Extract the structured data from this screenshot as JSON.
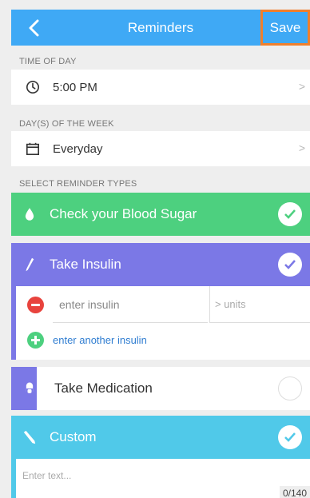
{
  "header": {
    "title": "Reminders",
    "save_label": "Save"
  },
  "time_section": {
    "label": "TIME OF DAY",
    "value": "5:00 PM"
  },
  "days_section": {
    "label": "DAY(S) OF THE WEEK",
    "value": "Everyday"
  },
  "types_section": {
    "label": "SELECT REMINDER TYPES"
  },
  "reminder_types": [
    {
      "label": "Check your Blood Sugar",
      "checked": true,
      "color": "#4dd07f"
    },
    {
      "label": "Take Insulin",
      "checked": true,
      "color": "#7b78e6"
    },
    {
      "label": "Take Medication",
      "checked": false,
      "color": "#7b78e6"
    },
    {
      "label": "Custom",
      "checked": true,
      "color": "#50c9e9"
    }
  ],
  "insulin": {
    "input_placeholder": "enter insulin",
    "units_placeholder": "> units",
    "add_another_label": "enter another insulin"
  },
  "custom_text": {
    "placeholder": "Enter text...",
    "counter": "0/140"
  },
  "colors": {
    "header": "#3fa9f5",
    "save_outline": "#f07f2c",
    "remove": "#e8433d",
    "add": "#4dd07f"
  }
}
